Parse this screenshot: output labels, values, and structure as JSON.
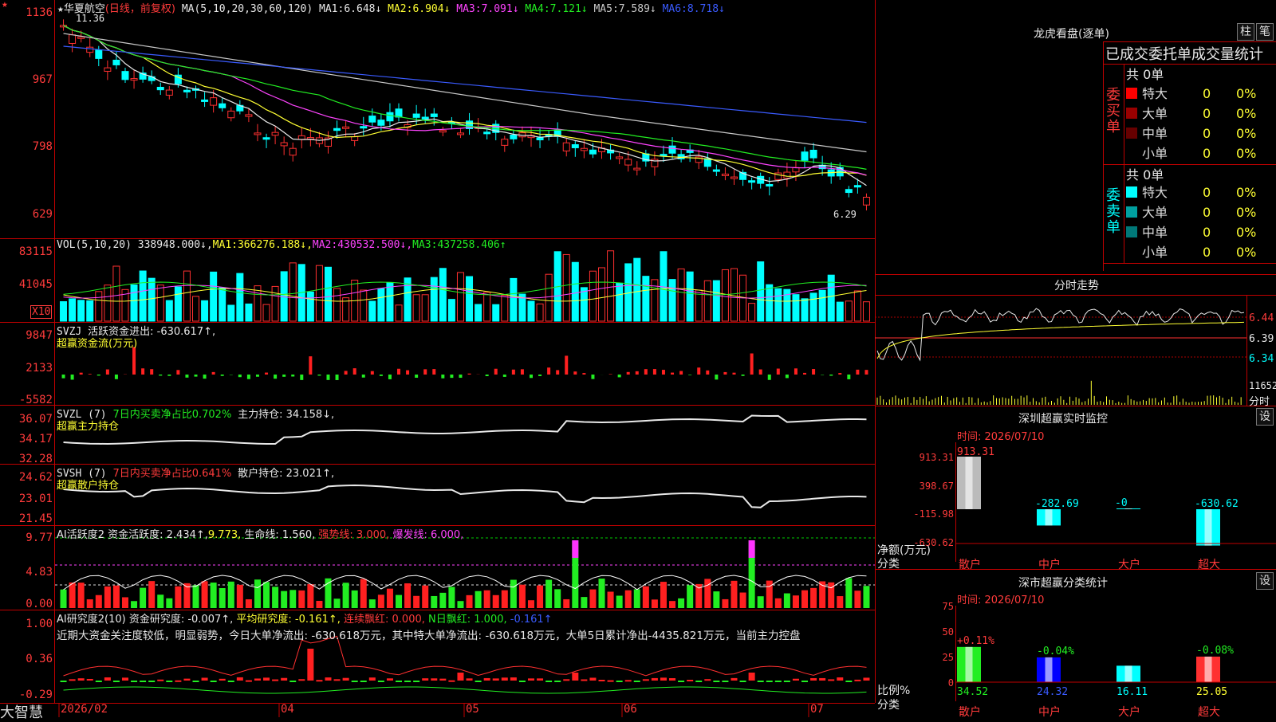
{
  "main": {
    "stock_name": "华夏航空",
    "period": "(日线，前复权)",
    "ma_header": "MA(5,10,20,30,60,120)",
    "ma": [
      {
        "label": "MA1:",
        "value": "6.648↓",
        "color": "#e8e8e8"
      },
      {
        "label": "MA2:",
        "value": "6.904↓",
        "color": "#ffff33"
      },
      {
        "label": "MA3:",
        "value": "7.091↓",
        "color": "#ff44ff"
      },
      {
        "label": "MA4:",
        "value": "7.121↓",
        "color": "#22ee22"
      },
      {
        "label": "MA5:",
        "value": "7.589↓",
        "color": "#c8c8c8"
      },
      {
        "label": "MA6:",
        "value": "8.718↓",
        "color": "#3a5bff"
      }
    ],
    "y_ticks": [
      "1136",
      "967",
      "798",
      "629"
    ],
    "high_label": "11.36",
    "low_label": "6.29"
  },
  "vol": {
    "header_label": "VOL(5,10,20)",
    "value": "338948.000↓,",
    "ma": [
      {
        "label": "MA1:",
        "value": "366276.188↓,"
      },
      {
        "label": "MA2:",
        "value": "430532.500↓,"
      },
      {
        "label": "MA3:",
        "value": "437258.406↑"
      }
    ],
    "y_ticks": [
      "83115",
      "41045"
    ],
    "unit": "X10"
  },
  "svzj": {
    "header_label": "SVZJ",
    "value_text": "活跃资金进出: -630.617↑,",
    "subtitle": "超赢资金流(万元)",
    "y_ticks": [
      "9847",
      "2133",
      "-5582"
    ]
  },
  "svzl": {
    "header_label": "SVZL (7)",
    "ratio": "7日内买卖净占比0.702%",
    "holding": "主力持仓: 34.158↓,",
    "subtitle": "超赢主力持仓",
    "y_ticks": [
      "36.07",
      "34.17",
      "32.28"
    ]
  },
  "svsh": {
    "header_label": "SVSH (7)",
    "ratio": "7日内买卖净占比0.641%",
    "holding": "散户持仓: 23.021↑,",
    "subtitle": "超赢散户持仓",
    "y_ticks": [
      "24.62",
      "23.01",
      "21.45"
    ]
  },
  "ai_active": {
    "header_label": "AI活跃度2",
    "value_text": "资金活跃度: 2.434↑,",
    "value2": "9.773,",
    "life_line": "生命线: 1.560,",
    "strong_line": "强势线: 3.000,",
    "burst_line": "爆发线: 6.000,",
    "y_ticks": [
      "9.77",
      "4.83",
      "0.00"
    ]
  },
  "ai_research": {
    "header_label": "AI研究度2(10)",
    "value_text": "资金研究度: -0.007↑,",
    "avg_text": "平均研究度: -0.161↑,",
    "cont_red": "连续飘红: 0.000,",
    "n_red": "N日飘红: 1.000,",
    "last": "-0.161↑",
    "comment": "近期大资金关注度较低，明显弱势，今日大单净流出: -630.618万元，其中特大单净流出: -630.618万元，大单5日累计净出-4435.821万元，当前主力控盘",
    "y_ticks": [
      "1.00",
      "0.36",
      "-0.29"
    ]
  },
  "x_axis": [
    "2026/02",
    "04",
    "05",
    "06",
    "07"
  ],
  "brand": "大智慧",
  "right": {
    "dragon_title": "龙虎看盘(逐单)",
    "btn1": "柱",
    "btn2": "笔",
    "stats_title": "已成交委托单成交量统计",
    "buy": {
      "side_label": "委买单",
      "total": "共 0单",
      "rows": [
        {
          "name": "特大",
          "count": "0",
          "pct": "0%",
          "color": "#ff0000"
        },
        {
          "name": "大单",
          "count": "0",
          "pct": "0%",
          "color": "#990000"
        },
        {
          "name": "中单",
          "count": "0",
          "pct": "0%",
          "color": "#660000"
        },
        {
          "name": "小单",
          "count": "0",
          "pct": "0%",
          "color": "#000000"
        }
      ]
    },
    "sell": {
      "side_label": "委卖单",
      "total": "共 0单",
      "rows": [
        {
          "name": "特大",
          "count": "0",
          "pct": "0%",
          "color": "#00ffff"
        },
        {
          "name": "大单",
          "count": "0",
          "pct": "0%",
          "color": "#00a0a0"
        },
        {
          "name": "中单",
          "count": "0",
          "pct": "0%",
          "color": "#007878"
        },
        {
          "name": "小单",
          "count": "0",
          "pct": "0%",
          "color": "#000000"
        }
      ]
    },
    "intraday": {
      "title": "分时走势",
      "y_ticks": [
        "6.44",
        "6.39",
        "6.34"
      ],
      "vol_label": "11652",
      "period_label": "分时"
    },
    "monitor": {
      "title": "深圳超赢实时监控",
      "btn": "设",
      "time": "时间: 2026/07/10",
      "y_ticks": [
        "913.31",
        "398.67",
        "-115.98",
        "-630.62"
      ],
      "unit": "净额(万元)",
      "cat_label": "分类",
      "categories": [
        "散户",
        "中户",
        "大户",
        "超大"
      ],
      "values": [
        "913.31",
        "-282.69",
        "-0",
        "-630.62"
      ]
    },
    "classify": {
      "title": "深市超赢分类统计",
      "btn": "设",
      "time": "时间: 2026/07/10",
      "y_ticks": [
        "75",
        "50",
        "25",
        "0"
      ],
      "unit": "比例%",
      "cat_label": "分类",
      "categories": [
        "散户",
        "中户",
        "大户",
        "超大"
      ],
      "values": [
        "34.52",
        "24.32",
        "16.11",
        "25.05"
      ],
      "changes": [
        "+0.11%",
        "-0.04%",
        "",
        "-0.08%"
      ]
    }
  }
}
